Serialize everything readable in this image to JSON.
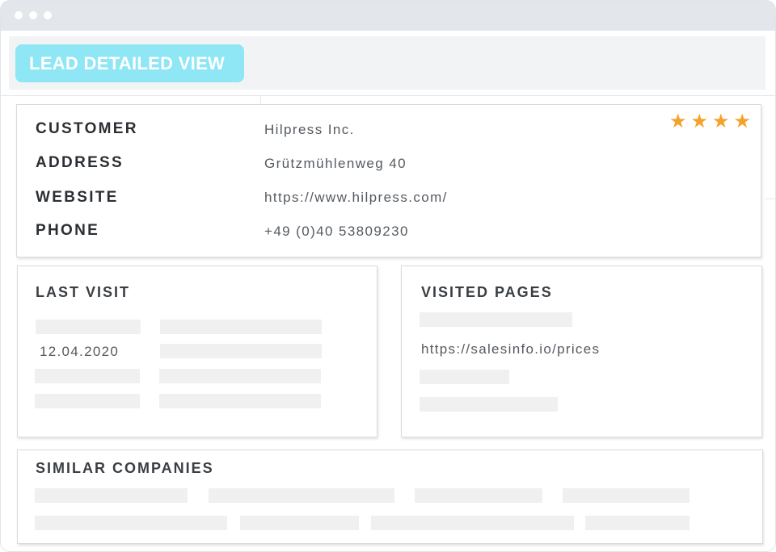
{
  "header": {
    "title": "LEAD DETAILED VIEW"
  },
  "lead": {
    "rating": 4,
    "rating_icons": [
      "star-icon",
      "star-icon",
      "star-icon",
      "star-icon"
    ],
    "fields": [
      {
        "label": "CUSTOMER",
        "value": "Hilpress Inc."
      },
      {
        "label": "ADDRESS",
        "value": "Grützmühlenweg 40"
      },
      {
        "label": "WEBSITE",
        "value": "https://www.hilpress.com/"
      },
      {
        "label": "PHONE",
        "value": "+49 (0)40 53809230"
      }
    ]
  },
  "last_visit": {
    "title": "LAST VISIT",
    "date": "12.04.2020"
  },
  "visited_pages": {
    "title": "VISITED PAGES",
    "url": "https://salesinfo.io/prices"
  },
  "similar_companies": {
    "title": "SIMILAR COMPANIES"
  },
  "colors": {
    "accent": "#8fe6f5",
    "star": "#f5a12a",
    "placeholder_bar": "#f0f0f1",
    "titlebar": "#e3e6ea"
  }
}
